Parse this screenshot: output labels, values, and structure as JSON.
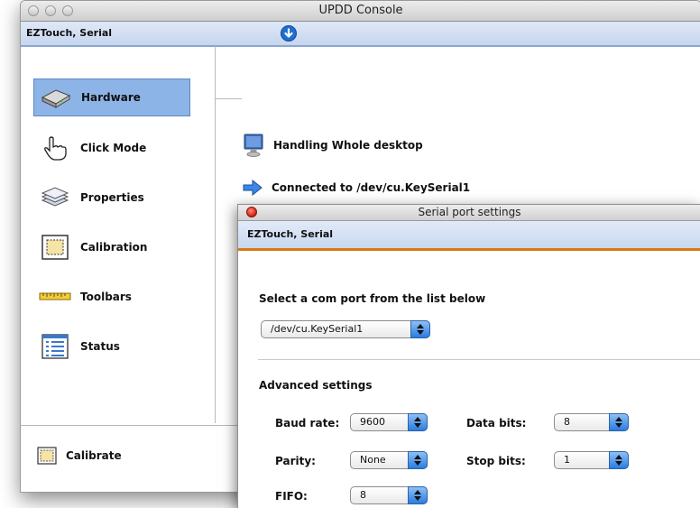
{
  "window": {
    "title": "UPDD Console"
  },
  "device": {
    "name": "EZTouch, Serial"
  },
  "sidebar": {
    "items": [
      {
        "label": "Hardware",
        "icon": "hardware-icon",
        "selected": true
      },
      {
        "label": "Click Mode",
        "icon": "hand-pointer-icon"
      },
      {
        "label": "Properties",
        "icon": "layers-icon"
      },
      {
        "label": "Calibration",
        "icon": "calibration-icon"
      },
      {
        "label": "Toolbars",
        "icon": "ruler-icon"
      },
      {
        "label": "Status",
        "icon": "status-list-icon"
      }
    ],
    "calibrate": "Calibrate"
  },
  "main": {
    "handling": "Handling Whole desktop",
    "connected": "Connected to /dev/cu.KeySerial1"
  },
  "dialog": {
    "title": "Serial port settings",
    "device": "EZTouch, Serial",
    "port_prompt": "Select a com port from the list below",
    "port_value": "/dev/cu.KeySerial1",
    "advanced_heading": "Advanced settings",
    "baud_label": "Baud rate:",
    "baud_value": "9600",
    "databits_label": "Data bits:",
    "databits_value": "8",
    "parity_label": "Parity:",
    "parity_value": "None",
    "stopbits_label": "Stop bits:",
    "stopbits_value": "1",
    "fifo_label": "FIFO:",
    "fifo_value": "8"
  },
  "colors": {
    "selection": "#8db4e6",
    "accent": "#2a7ce0",
    "divider": "#d77a12"
  }
}
